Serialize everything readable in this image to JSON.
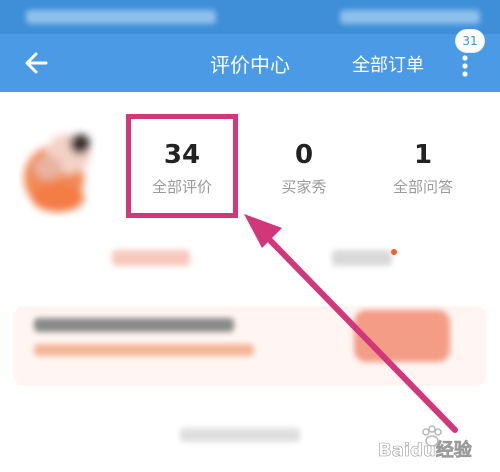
{
  "header": {
    "title": "评价中心",
    "all_orders": "全部订单",
    "badge_count": "31",
    "back_icon": "arrow-left-icon",
    "more_icon": "more-vertical-icon"
  },
  "stats": [
    {
      "value": "34",
      "label": "全部评价"
    },
    {
      "value": "0",
      "label": "买家秀"
    },
    {
      "value": "1",
      "label": "全部问答"
    }
  ],
  "watermark": "Baidu经验",
  "colors": {
    "header_blue": "#4a9ae6",
    "highlight_pink": "#d2377a"
  }
}
